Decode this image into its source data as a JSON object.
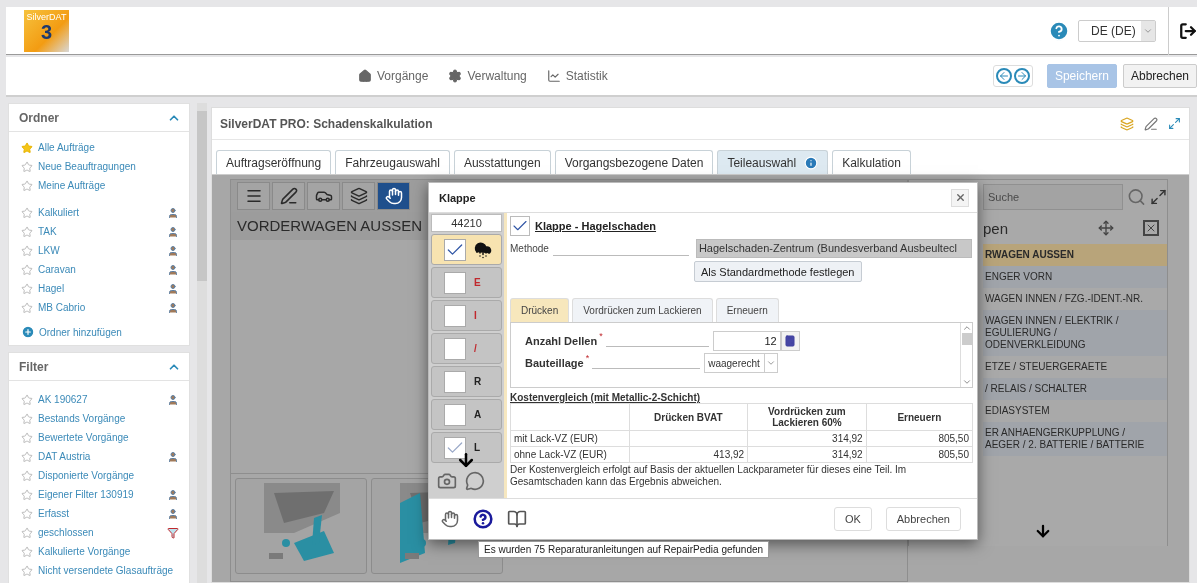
{
  "header": {
    "logo_text": "SilverDAT",
    "logo_number": "3",
    "language": "DE (DE)"
  },
  "nav": {
    "items": [
      "Vorgänge",
      "Verwaltung",
      "Statistik"
    ],
    "save": "Speichern",
    "save_disabled": true,
    "cancel": "Abbrechen"
  },
  "sidebar": {
    "folders": {
      "title": "Ordner",
      "expanded": true,
      "sections": [
        {
          "items": [
            {
              "label": "Alle Aufträge",
              "starred": true
            },
            {
              "label": "Neue Beauftragungen",
              "starred": false
            },
            {
              "label": "Meine Aufträge",
              "starred": false
            }
          ]
        },
        {
          "items": [
            {
              "label": "Kalkuliert",
              "starred": false,
              "user_badge": true
            },
            {
              "label": "TAK",
              "starred": false,
              "user_badge": true
            },
            {
              "label": "LKW",
              "starred": false,
              "user_badge": true
            },
            {
              "label": "Caravan",
              "starred": false,
              "user_badge": true
            },
            {
              "label": "Hagel",
              "starred": false,
              "user_badge": true
            },
            {
              "label": "MB Cabrio",
              "starred": false,
              "user_badge": true
            }
          ]
        }
      ],
      "add": "Ordner hinzufügen"
    },
    "filter": {
      "title": "Filter",
      "expanded": true,
      "items": [
        {
          "label": "AK 190627",
          "starred": false,
          "user_badge": true
        },
        {
          "label": "Bestands Vorgänge",
          "starred": false
        },
        {
          "label": "Bewertete Vorgänge",
          "starred": false
        },
        {
          "label": "DAT Austria",
          "starred": false,
          "user_badge": true
        },
        {
          "label": "Disponierte Vorgänge",
          "starred": false
        },
        {
          "label": "Eigener Filter 130919",
          "starred": false,
          "user_badge": true
        },
        {
          "label": "Erfasst",
          "starred": false,
          "user_badge": true
        },
        {
          "label": "geschlossen",
          "starred": false,
          "filter_badge": true
        },
        {
          "label": "Kalkulierte Vorgänge",
          "starred": false
        },
        {
          "label": "Nicht versendete Glasaufträge",
          "starred": false
        }
      ]
    }
  },
  "panel": {
    "title": "SilverDAT PRO: Schadenskalkulation",
    "tabs": [
      {
        "label": "Auftragseröffnung",
        "selected": false
      },
      {
        "label": "Fahrzeugauswahl",
        "selected": false
      },
      {
        "label": "Ausstattungen",
        "selected": false
      },
      {
        "label": "Vorgangsbezogene Daten",
        "selected": false
      },
      {
        "label": "Teileauswahl",
        "selected": true,
        "info": true
      },
      {
        "label": "Kalkulation",
        "selected": false
      }
    ]
  },
  "workspace": {
    "tools": [
      {
        "selected": false
      },
      {
        "selected": false
      },
      {
        "selected": false
      },
      {
        "selected": false
      },
      {
        "selected": true
      }
    ],
    "section_title": "VORDERWAGEN AUSSEN",
    "groups_panel": {
      "search_placeholder": "Suche",
      "heading": "pen",
      "items": [
        {
          "label": "RWAGEN AUSSEN",
          "selected": true
        },
        {
          "label": "ENGER VORN",
          "selected": false
        },
        {
          "label": "WAGEN INNEN / FZG.-IDENT.-NR.",
          "selected": false
        },
        {
          "label": "WAGEN INNEN / ELEKTRIK / \nEGULIERUNG / \nODENVERKLEIDUNG",
          "selected": false
        },
        {
          "label": "ETZE / STEUERGERAETE",
          "selected": false
        },
        {
          "label": "/ RELAIS / SCHALTER",
          "selected": false
        },
        {
          "label": "EDIASYSTEM",
          "selected": false
        },
        {
          "label": "ER ANHAENGERKUPPLUNG / \nAEGER / 2. BATTERIE / BATTERIE",
          "selected": false
        }
      ]
    }
  },
  "dialog": {
    "title": "Klappe",
    "part_number": "44210",
    "options": [
      {
        "kind": "hail",
        "checked": true,
        "selected": true
      },
      {
        "kind": "letter",
        "letter": "E",
        "color": "#c0282d",
        "checked": false,
        "selected": false
      },
      {
        "kind": "letter",
        "letter": "I",
        "color": "#c0282d",
        "checked": false,
        "selected": false
      },
      {
        "kind": "letter",
        "letter": "/",
        "color": "#c0282d",
        "checked": false,
        "selected": false
      },
      {
        "kind": "letter",
        "letter": "R",
        "color": "#222222",
        "checked": false,
        "selected": false
      },
      {
        "kind": "letter",
        "letter": "A",
        "color": "#222222",
        "checked": false,
        "selected": false
      },
      {
        "kind": "letter",
        "letter": "L",
        "color": "#222222",
        "checked": true,
        "selected": false
      }
    ],
    "heading": "Klappe - Hagelschaden",
    "heading_checked": true,
    "method_label": "Methode",
    "method_value": "Hagelschaden-Zentrum (Bundesverband Ausbeultecl",
    "default_button": "Als Standardmethode festlegen",
    "tabs": [
      {
        "label": "Drücken",
        "selected": true
      },
      {
        "label": "Vordrücken zum Lackieren",
        "selected": false
      },
      {
        "label": "Erneuern",
        "selected": false
      }
    ],
    "fields": [
      {
        "kind": "number",
        "label": "Anzahl Dellen",
        "required_mark": "*",
        "value": "12"
      },
      {
        "kind": "select",
        "label": "Bauteillage",
        "required_mark": "*",
        "value": "waagerecht"
      }
    ],
    "comparison": {
      "title": "Kostenvergleich (mit Metallic-2-Schicht)",
      "columns": [
        "Drücken BVAT",
        "Vordrücken zum Lackieren 60%",
        "Erneuern"
      ],
      "rows": [
        {
          "label": "mit Lack-VZ (EUR)",
          "cells": [
            null,
            "314,92",
            "805,50"
          ]
        },
        {
          "label": "ohne Lack-VZ (EUR)",
          "cells": [
            "413,92",
            "314,92",
            "805,50"
          ]
        }
      ],
      "note": "Der Kostenvergleich erfolgt auf Basis der aktuellen Lackparameter für dieses eine Teil. Im Gesamtschaden kann das Ergebnis abweichen."
    },
    "ok": "OK",
    "cancel": "Abbrechen",
    "tooltip": "Es wurden 75 Reparaturanleitungen auf RepairPedia gefunden"
  }
}
